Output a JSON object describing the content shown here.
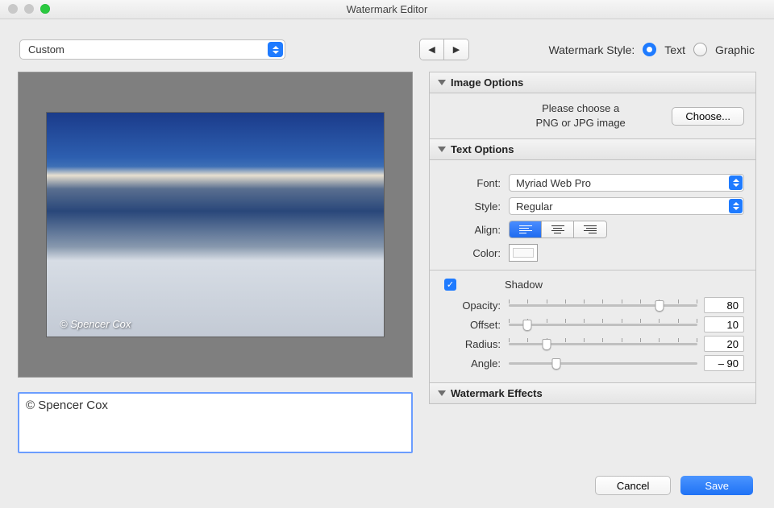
{
  "window": {
    "title": "Watermark Editor"
  },
  "preset": {
    "value": "Custom"
  },
  "style": {
    "label": "Watermark Style:",
    "text_label": "Text",
    "graphic_label": "Graphic",
    "selected": "text"
  },
  "preview": {
    "watermark_text": "© Spencer Cox"
  },
  "watermark_input": {
    "value": "© Spencer Cox"
  },
  "panels": {
    "image_options": {
      "title": "Image Options",
      "hint_line1": "Please choose a",
      "hint_line2": "PNG or JPG image",
      "choose_label": "Choose..."
    },
    "text_options": {
      "title": "Text Options",
      "font_label": "Font:",
      "font_value": "Myriad Web Pro",
      "style_label": "Style:",
      "style_value": "Regular",
      "align_label": "Align:",
      "align_selected": "left",
      "color_label": "Color:",
      "shadow": {
        "checkbox_checked": true,
        "label": "Shadow",
        "opacity_label": "Opacity:",
        "opacity_value": 80,
        "offset_label": "Offset:",
        "offset_value": 10,
        "radius_label": "Radius:",
        "radius_value": 20,
        "angle_label": "Angle:",
        "angle_value": "– 90"
      }
    },
    "watermark_effects": {
      "title": "Watermark Effects"
    }
  },
  "footer": {
    "cancel": "Cancel",
    "save": "Save"
  }
}
